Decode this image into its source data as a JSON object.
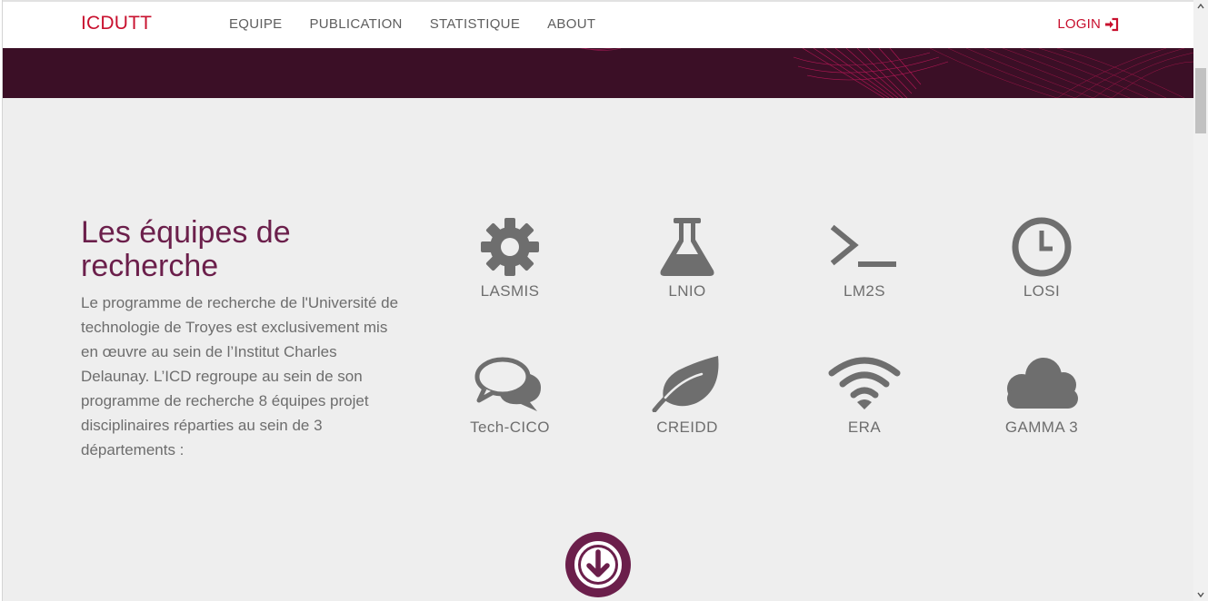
{
  "nav": {
    "brand": "ICDUTT",
    "links": [
      "EQUIPE",
      "PUBLICATION",
      "STATISTIQUE",
      "ABOUT"
    ],
    "login": "LOGIN",
    "login_icon": "sign-in-icon"
  },
  "section": {
    "title": "Les équipes de recherche",
    "description": "Le programme de recherche de l'Université de technologie de Troyes est exclusivement mis en œuvre au sein de l’Institut Charles Delaunay. L’ICD regroupe au sein de son programme de recherche 8 équipes projet disciplinaires réparties au sein de 3 départements :"
  },
  "teams": [
    {
      "label": "LASMIS",
      "icon": "gear-icon"
    },
    {
      "label": "LNIO",
      "icon": "flask-icon"
    },
    {
      "label": "LM2S",
      "icon": "terminal-icon"
    },
    {
      "label": "LOSI",
      "icon": "clock-icon"
    },
    {
      "label": "Tech-CICO",
      "icon": "chat-icon"
    },
    {
      "label": "CREIDD",
      "icon": "leaf-icon"
    },
    {
      "label": "ERA",
      "icon": "wifi-icon"
    },
    {
      "label": "GAMMA 3",
      "icon": "cloud-icon"
    }
  ],
  "scroll_down_icon": "arrow-circle-down-icon",
  "colors": {
    "brand": "#c8102e",
    "accent": "#6b1f4b",
    "hero_bg": "#3b0f26",
    "icon_gray": "#6e6e6e",
    "page_bg": "#eeeeee"
  }
}
